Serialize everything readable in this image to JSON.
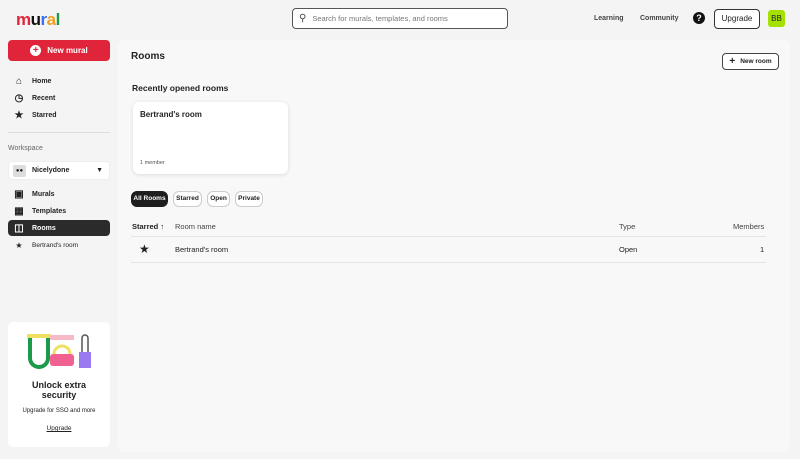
{
  "header": {
    "logo": "mural",
    "search_placeholder": "Search for murals, templates, and rooms",
    "links": [
      "Learning",
      "Community"
    ],
    "help": "?",
    "upgrade": "Upgrade",
    "avatar": "BB"
  },
  "sidebar": {
    "new_mural": "New mural",
    "nav": [
      "Home",
      "Recent",
      "Starred"
    ],
    "workspace_label": "Workspace",
    "workspace": "Nicelydone",
    "ws_nav": [
      "Murals",
      "Templates",
      "Rooms"
    ],
    "starred_room": "Bertrand's room",
    "promo": {
      "title": "Unlock extra security",
      "subtitle": "Upgrade for SSO and more",
      "link": "Upgrade"
    }
  },
  "main": {
    "title": "Rooms",
    "new_room": "New room",
    "recent_heading": "Recently opened rooms",
    "recent_card": {
      "name": "Bertrand's room",
      "members": "1 member"
    },
    "filters": [
      "All Rooms",
      "Starred",
      "Open",
      "Private"
    ],
    "table": {
      "headers": [
        "Starred",
        "Room name",
        "Type",
        "Members"
      ],
      "rows": [
        {
          "name": "Bertrand's room",
          "type": "Open",
          "members": "1"
        }
      ]
    }
  },
  "colors": {
    "brand": "#e0253a",
    "avatar": "#a4e000"
  }
}
